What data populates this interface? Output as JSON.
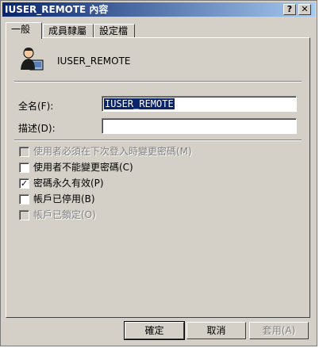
{
  "window": {
    "title": "IUSER_REMOTE 內容",
    "help_btn": "?",
    "close_btn": "✕"
  },
  "tabs": [
    {
      "label": "一般"
    },
    {
      "label": "成員隸屬"
    },
    {
      "label": "設定檔"
    }
  ],
  "user": {
    "name": "IUSER_REMOTE",
    "avatar_icon": "user-icon"
  },
  "fields": {
    "fullname_label": "全名(F):",
    "fullname_value": "IUSER_REMOTE",
    "description_label": "描述(D):",
    "description_value": ""
  },
  "options": [
    {
      "label": "使用者必須在下次登入時變更密碼(M)",
      "checked": false,
      "enabled": false
    },
    {
      "label": "使用者不能變更密碼(C)",
      "checked": false,
      "enabled": true
    },
    {
      "label": "密碼永久有效(P)",
      "checked": true,
      "enabled": true
    },
    {
      "label": "帳戶已停用(B)",
      "checked": false,
      "enabled": true
    },
    {
      "label": "帳戶已鎖定(O)",
      "checked": false,
      "enabled": false
    }
  ],
  "buttons": {
    "ok": "確定",
    "cancel": "取消",
    "apply": "套用(A)"
  }
}
